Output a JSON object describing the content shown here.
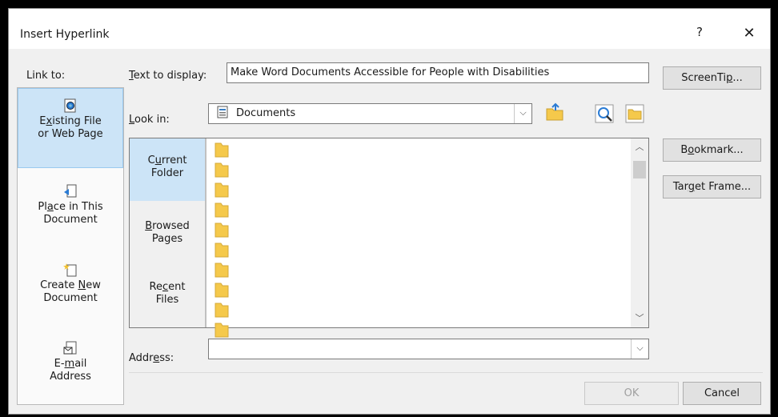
{
  "dialog": {
    "title": "Insert Hyperlink",
    "help": "?",
    "close": "✕"
  },
  "link_to": {
    "label": "Link to:",
    "items": [
      {
        "label_pre": "E",
        "label_u": "x",
        "label_post": "isting File",
        "line2": "or Web Page",
        "icon": "web-page-icon"
      },
      {
        "label_pre": "Pl",
        "label_u": "a",
        "label_post": "ce in This",
        "line2": "Document",
        "icon": "place-in-document-icon"
      },
      {
        "label_pre": "Create ",
        "label_u": "N",
        "label_post": "ew",
        "line2": "Document",
        "icon": "new-document-icon"
      },
      {
        "label_pre": "E-",
        "label_u": "m",
        "label_post": "ail",
        "line2": "Address",
        "icon": "email-icon"
      }
    ]
  },
  "text_to_display": {
    "label_u": "T",
    "label_rest": "ext to display:",
    "value": "Make Word Documents Accessible for People with Disabilities"
  },
  "look_in": {
    "label_u": "L",
    "label_rest": "ook in:",
    "value": "Documents",
    "icon": "documents-folder-icon"
  },
  "browse_tabs": [
    {
      "pre": "C",
      "u": "u",
      "post": "rrent",
      "line2": "Folder"
    },
    {
      "pre": "",
      "u": "B",
      "post": "rowsed",
      "line2": "Pages"
    },
    {
      "pre": "Re",
      "u": "c",
      "post": "ent",
      "line2": "Files"
    }
  ],
  "file_list": {
    "folder_count_visible": 10
  },
  "address": {
    "label_pre": "Addr",
    "label_u": "e",
    "label_post": "ss:",
    "value": ""
  },
  "buttons": {
    "screentip_pre": "ScreenTi",
    "screentip_u": "p",
    "screentip_post": "...",
    "bookmark_pre": "B",
    "bookmark_u": "o",
    "bookmark_post": "okmark...",
    "target_pre": "Tar",
    "target_u": "g",
    "target_post": "et Frame...",
    "ok": "OK",
    "cancel": "Cancel"
  },
  "colors": {
    "selected_bg": "#cce4f7",
    "folder_yellow": "#f5c94b"
  }
}
